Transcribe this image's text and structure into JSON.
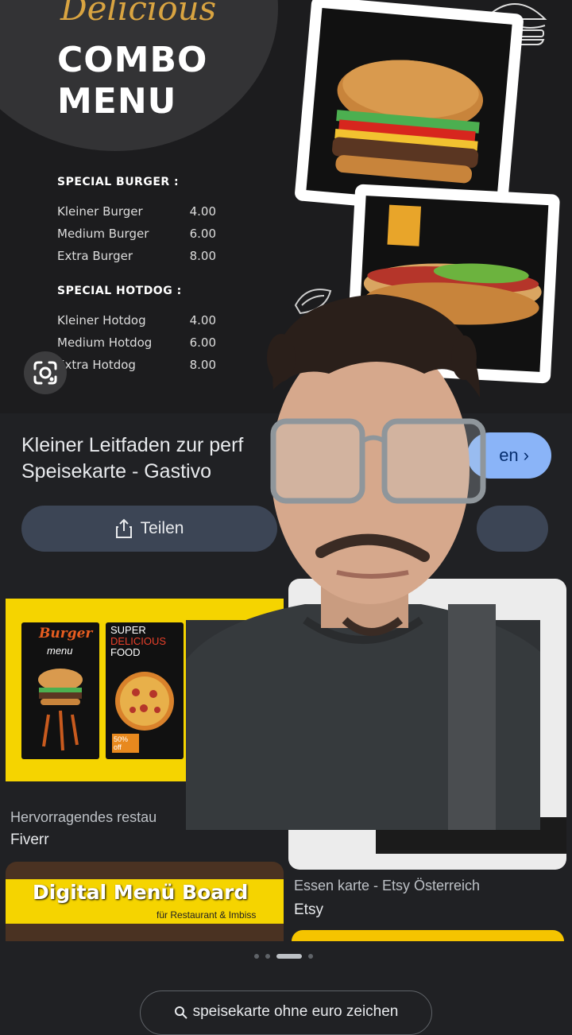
{
  "menu_image": {
    "script_title": "Delicious",
    "title_line1": "COMBO",
    "title_line2": "MENU",
    "sections": [
      {
        "title": "SPECIAL BURGER :",
        "items": [
          {
            "name": "Kleiner Burger",
            "price": "4.00"
          },
          {
            "name": "Medium Burger",
            "price": "6.00"
          },
          {
            "name": "Extra Burger",
            "price": "8.00"
          }
        ]
      },
      {
        "title": "SPECIAL HOTDOG :",
        "items": [
          {
            "name": "Kleiner Hotdog",
            "price": "4.00"
          },
          {
            "name": "Medium Hotdog",
            "price": "6.00"
          },
          {
            "name": "Extra Hotdog",
            "price": "8.00"
          }
        ]
      }
    ]
  },
  "result": {
    "title_line1": "Kleiner Leitfaden zur perf",
    "title_line2": "Speisekarte - Gastivo",
    "visit_label": "en",
    "share_label": "Teilen"
  },
  "related": [
    {
      "thumb_text_1": "Burger",
      "thumb_text_2": "menu",
      "thumb_text_3": "SUPER",
      "thumb_text_4": "DELICIOUS",
      "thumb_text_5": "FOOD",
      "thumb_text_6": "50% off",
      "caption": "Hervorragendes restau",
      "source": "Fiverr"
    },
    {
      "caption": "Essen karte - Etsy Österreich",
      "source": "Etsy"
    },
    {
      "banner_title": "Digital Menü Board",
      "banner_sub": "für Restaurant & Imbiss"
    }
  ],
  "pagination": {
    "count": 4,
    "active": 2
  },
  "query_chip": "speisekarte ohne euro zeichen",
  "colors": {
    "background": "#202124",
    "accent": "#8ab4f8",
    "gold": "#d9a441",
    "yellow": "#f5d400"
  }
}
